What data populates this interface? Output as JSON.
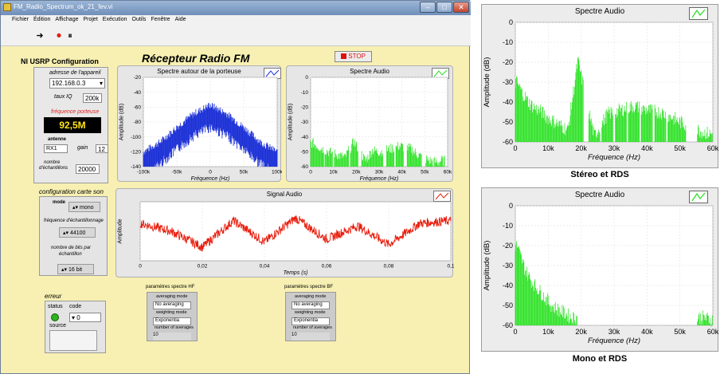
{
  "window": {
    "title": "FM_Radio_Spectrum_ok_21_fev.vi"
  },
  "menu": [
    "Fichier",
    "Édition",
    "Affichage",
    "Projet",
    "Exécution",
    "Outils",
    "Fenêtre",
    "Aide"
  ],
  "config": {
    "heading": "NI USRP Configuration",
    "device_address_label": "adresse de l'appareil",
    "device_address": "192.168.0.3",
    "iq_rate_label": "taux IQ",
    "iq_rate": "200k",
    "carrier_label": "fréquence porteuse",
    "carrier_value": "92,5M",
    "antenna_label": "antenne",
    "antenna": "RX1",
    "gain_label": "gain",
    "gain": "12",
    "samples_label_1": "nombre",
    "samples_label_2": "d'échantillons",
    "samples": "20000"
  },
  "receiver_title": "Récepteur Radio FM",
  "stop_label": "STOP",
  "plot_porteuse": {
    "title": "Spectre autour de la porteuse",
    "xlabel": "Fréquence (Hz)",
    "ylabel": "Amplitude (dB)",
    "color": "#1a2fd6"
  },
  "plot_audio_small": {
    "title": "Spectre Audio",
    "xlabel": "Fréquence (Hz)",
    "ylabel": "Amplitude (dB)",
    "color": "#22e01a"
  },
  "plot_signal": {
    "title": "Signal Audio",
    "xlabel": "Temps (s)",
    "ylabel": "Amplitude",
    "color": "#e81c0c"
  },
  "sound": {
    "heading": "configuration carte son",
    "mode_label": "mode",
    "mode": "mono",
    "rate_label": "fréquence d'échantillonnage",
    "rate": "44100",
    "bits_label_1": "nombre de bits par",
    "bits_label_2": "échantillon",
    "bits": "16 bit"
  },
  "error": {
    "heading": "erreur",
    "status_label": "status",
    "code_label": "code",
    "code": "0",
    "source_label": "source"
  },
  "hf": {
    "heading": "paramètres spectre HF",
    "avg_mode_label": "averaging mode",
    "avg_mode": "No averaging",
    "weight_label": "weighting mode",
    "weight": "Exponentia",
    "num_label": "number of averages",
    "num": "10"
  },
  "bf": {
    "heading": "paramètres spectre BF",
    "avg_mode_label": "averaging mode",
    "avg_mode": "No averaging",
    "weight_label": "weighting mode",
    "weight": "Exponentia",
    "num_label": "number of averages",
    "num": "10"
  },
  "big_plots": [
    {
      "title": "Spectre Audio",
      "xlabel": "Fréquence (Hz)",
      "ylabel": "Amplitude (dB)",
      "caption": "Stéreo et RDS"
    },
    {
      "title": "Spectre Audio",
      "xlabel": "Fréquence (Hz)",
      "ylabel": "Amplitude (dB)",
      "caption": "Mono et RDS"
    }
  ],
  "chart_data": [
    {
      "type": "area",
      "title": "Spectre autour de la porteuse",
      "xlabel": "Fréquence (Hz)",
      "ylabel": "Amplitude (dB)",
      "xlim": [
        -100000,
        100000
      ],
      "ylim": [
        -140,
        -20
      ],
      "x_ticks": [
        "-100k",
        "-50k",
        "0",
        "50k",
        "100k"
      ],
      "y_ticks": [
        -20,
        -40,
        -60,
        -80,
        -100,
        -120,
        -140
      ],
      "series": [
        {
          "x": [
            -100000,
            -75000,
            -50000,
            -25000,
            0,
            25000,
            50000,
            75000,
            100000
          ],
          "top": [
            -125,
            -112,
            -92,
            -74,
            -62,
            -74,
            -92,
            -112,
            -125
          ]
        }
      ]
    },
    {
      "type": "bar",
      "title": "Spectre Audio",
      "xlabel": "Fréquence (Hz)",
      "ylabel": "Amplitude (dB)",
      "xlim": [
        0,
        60000
      ],
      "ylim": [
        -60,
        0
      ],
      "x_ticks": [
        "0",
        "10k",
        "20k",
        "30k",
        "40k",
        "50k",
        "60k"
      ],
      "y_ticks": [
        0,
        -10,
        -20,
        -30,
        -40,
        -50,
        -60
      ],
      "series": [
        {
          "x": [
            1000,
            4000,
            8000,
            12000,
            15000,
            19000,
            24000,
            27000,
            30000,
            35000,
            39000,
            44000,
            47000,
            52000,
            56000,
            57000
          ],
          "values": [
            -44,
            -47,
            -50,
            -52,
            -54,
            -43,
            -56,
            -49,
            -50,
            -48,
            -46,
            -48,
            -52,
            -56,
            -57,
            -56
          ]
        }
      ]
    },
    {
      "type": "line",
      "title": "Signal Audio",
      "xlabel": "Temps (s)",
      "ylabel": "Amplitude",
      "xlim": [
        0,
        0.1
      ],
      "x_ticks": [
        "0",
        "0,02",
        "0,04",
        "0,06",
        "0,08",
        "0,1"
      ],
      "series": [
        {
          "x": [
            0,
            0.01,
            0.02,
            0.03,
            0.04,
            0.05,
            0.06,
            0.07,
            0.08,
            0.09,
            0.1
          ],
          "values": [
            0.3,
            0.0,
            -0.6,
            0.4,
            -0.4,
            0.5,
            -0.3,
            0.2,
            -0.5,
            0.3,
            0.4
          ]
        }
      ]
    },
    {
      "type": "bar",
      "title": "Spectre Audio",
      "xlabel": "Fréquence (Hz)",
      "ylabel": "Amplitude (dB)",
      "caption": "Stéreo et RDS",
      "xlim": [
        0,
        60000
      ],
      "ylim": [
        -60,
        0
      ],
      "x_ticks": [
        "0",
        "10k",
        "20k",
        "30k",
        "40k",
        "50k",
        "60k"
      ],
      "y_ticks": [
        0,
        -10,
        -20,
        -30,
        -40,
        -50,
        -60
      ],
      "series": [
        {
          "x": [
            500,
            2000,
            4000,
            6000,
            8000,
            10000,
            12000,
            14000,
            16000,
            19000,
            24000,
            28000,
            32000,
            36000,
            40000,
            44000,
            48000,
            50000,
            57000,
            59000
          ],
          "values": [
            -30,
            -35,
            -40,
            -43,
            -45,
            -48,
            -50,
            -52,
            -54,
            -19,
            -57,
            -46,
            -44,
            -42,
            -44,
            -45,
            -48,
            -50,
            -55,
            -56
          ]
        }
      ]
    },
    {
      "type": "bar",
      "title": "Spectre Audio",
      "xlabel": "Fréquence (Hz)",
      "ylabel": "Amplitude (dB)",
      "caption": "Mono et RDS",
      "xlim": [
        0,
        60000
      ],
      "ylim": [
        -60,
        0
      ],
      "x_ticks": [
        "0",
        "10k",
        "20k",
        "30k",
        "40k",
        "50k",
        "60k"
      ],
      "y_ticks": [
        0,
        -10,
        -20,
        -30,
        -40,
        -50,
        -60
      ],
      "series": [
        {
          "x": [
            500,
            1500,
            3000,
            5000,
            7000,
            9000,
            11000,
            13000,
            15000,
            17000,
            57000,
            59000
          ],
          "values": [
            -20,
            -25,
            -32,
            -38,
            -42,
            -46,
            -50,
            -52,
            -54,
            -56,
            -56,
            -57
          ]
        }
      ]
    }
  ]
}
